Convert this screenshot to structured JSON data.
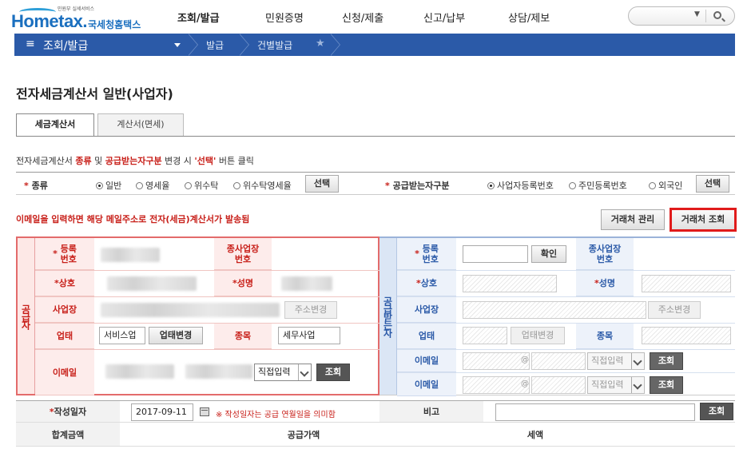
{
  "header": {
    "logo_tagline": "민원부 실세서비스",
    "logo_text": "Hometax.",
    "logo_korean": "국세청홈택스",
    "menu": [
      "조회/발급",
      "민원증명",
      "신청/제출",
      "신고/납부",
      "상담/제보"
    ]
  },
  "nav": {
    "menu_icon": "≡",
    "section": "조회/발급",
    "crumbs": [
      "발급",
      "건별발급"
    ],
    "star": "★"
  },
  "page": {
    "title": "전자세금계산서 일반(사업자)"
  },
  "tabs": [
    "세금계산서",
    "계산서(면세)"
  ],
  "notice": {
    "p1": "전자세금계산서 ",
    "k1": "종류",
    "p2": " 및 ",
    "k2": "공급받는자구분",
    "p3": " 변경 시 ",
    "k3": "'선택'",
    "p4": " 버튼 클릭"
  },
  "type_row": {
    "req": "*",
    "type_label": "종류",
    "type_options": [
      "일반",
      "영세율",
      "위수탁",
      "위수탁영세율"
    ],
    "type_selected": 0,
    "select_button": "선택",
    "recipient_label": "공급받는자구분",
    "recipient_options": [
      "사업자등록번호",
      "주민등록번호",
      "외국인"
    ],
    "recipient_selected": 0
  },
  "email_notice": "이메일을 입력하면 해당 메일주소로 전자(세금)계산서가 발송됨",
  "buttons": {
    "manage_partner": "거래처 관리",
    "search_partner": "거래처 조회"
  },
  "supplier": {
    "side_label": "공급자",
    "reg_no": "등록\n번호",
    "branch_no": "종사업장\n번호",
    "company": "상호",
    "name": "성명",
    "address": "사업장",
    "address_btn": "주소변경",
    "biz_type": "업태",
    "biz_type_value": "서비스업",
    "biz_type_btn": "업태변경",
    "biz_item": "종목",
    "biz_item_value": "세무사업",
    "email": "이메일",
    "email_select": "직접입력",
    "lookup_btn": "조회"
  },
  "buyer": {
    "side_label": "공급받는자",
    "reg_no": "등록\n번호",
    "confirm_btn": "확인",
    "branch_no": "종사업장\n번호",
    "company": "상호",
    "name": "성명",
    "address": "사업장",
    "address_btn": "주소변경",
    "biz_type": "업태",
    "biz_type_btn": "업태변경",
    "biz_item": "종목",
    "email": "이메일",
    "at": "@",
    "email_select": "직접입력",
    "lookup_btn": "조회"
  },
  "bottom": {
    "date_label": "작성일자",
    "date_value": "2017-09-11",
    "date_note": "※ 작성일자는 공급 연월일을 의미함",
    "remark_label": "비고",
    "remark_btn": "조회",
    "total_label": "합계금액",
    "supply_label": "공급가액",
    "tax_label": "세액"
  }
}
